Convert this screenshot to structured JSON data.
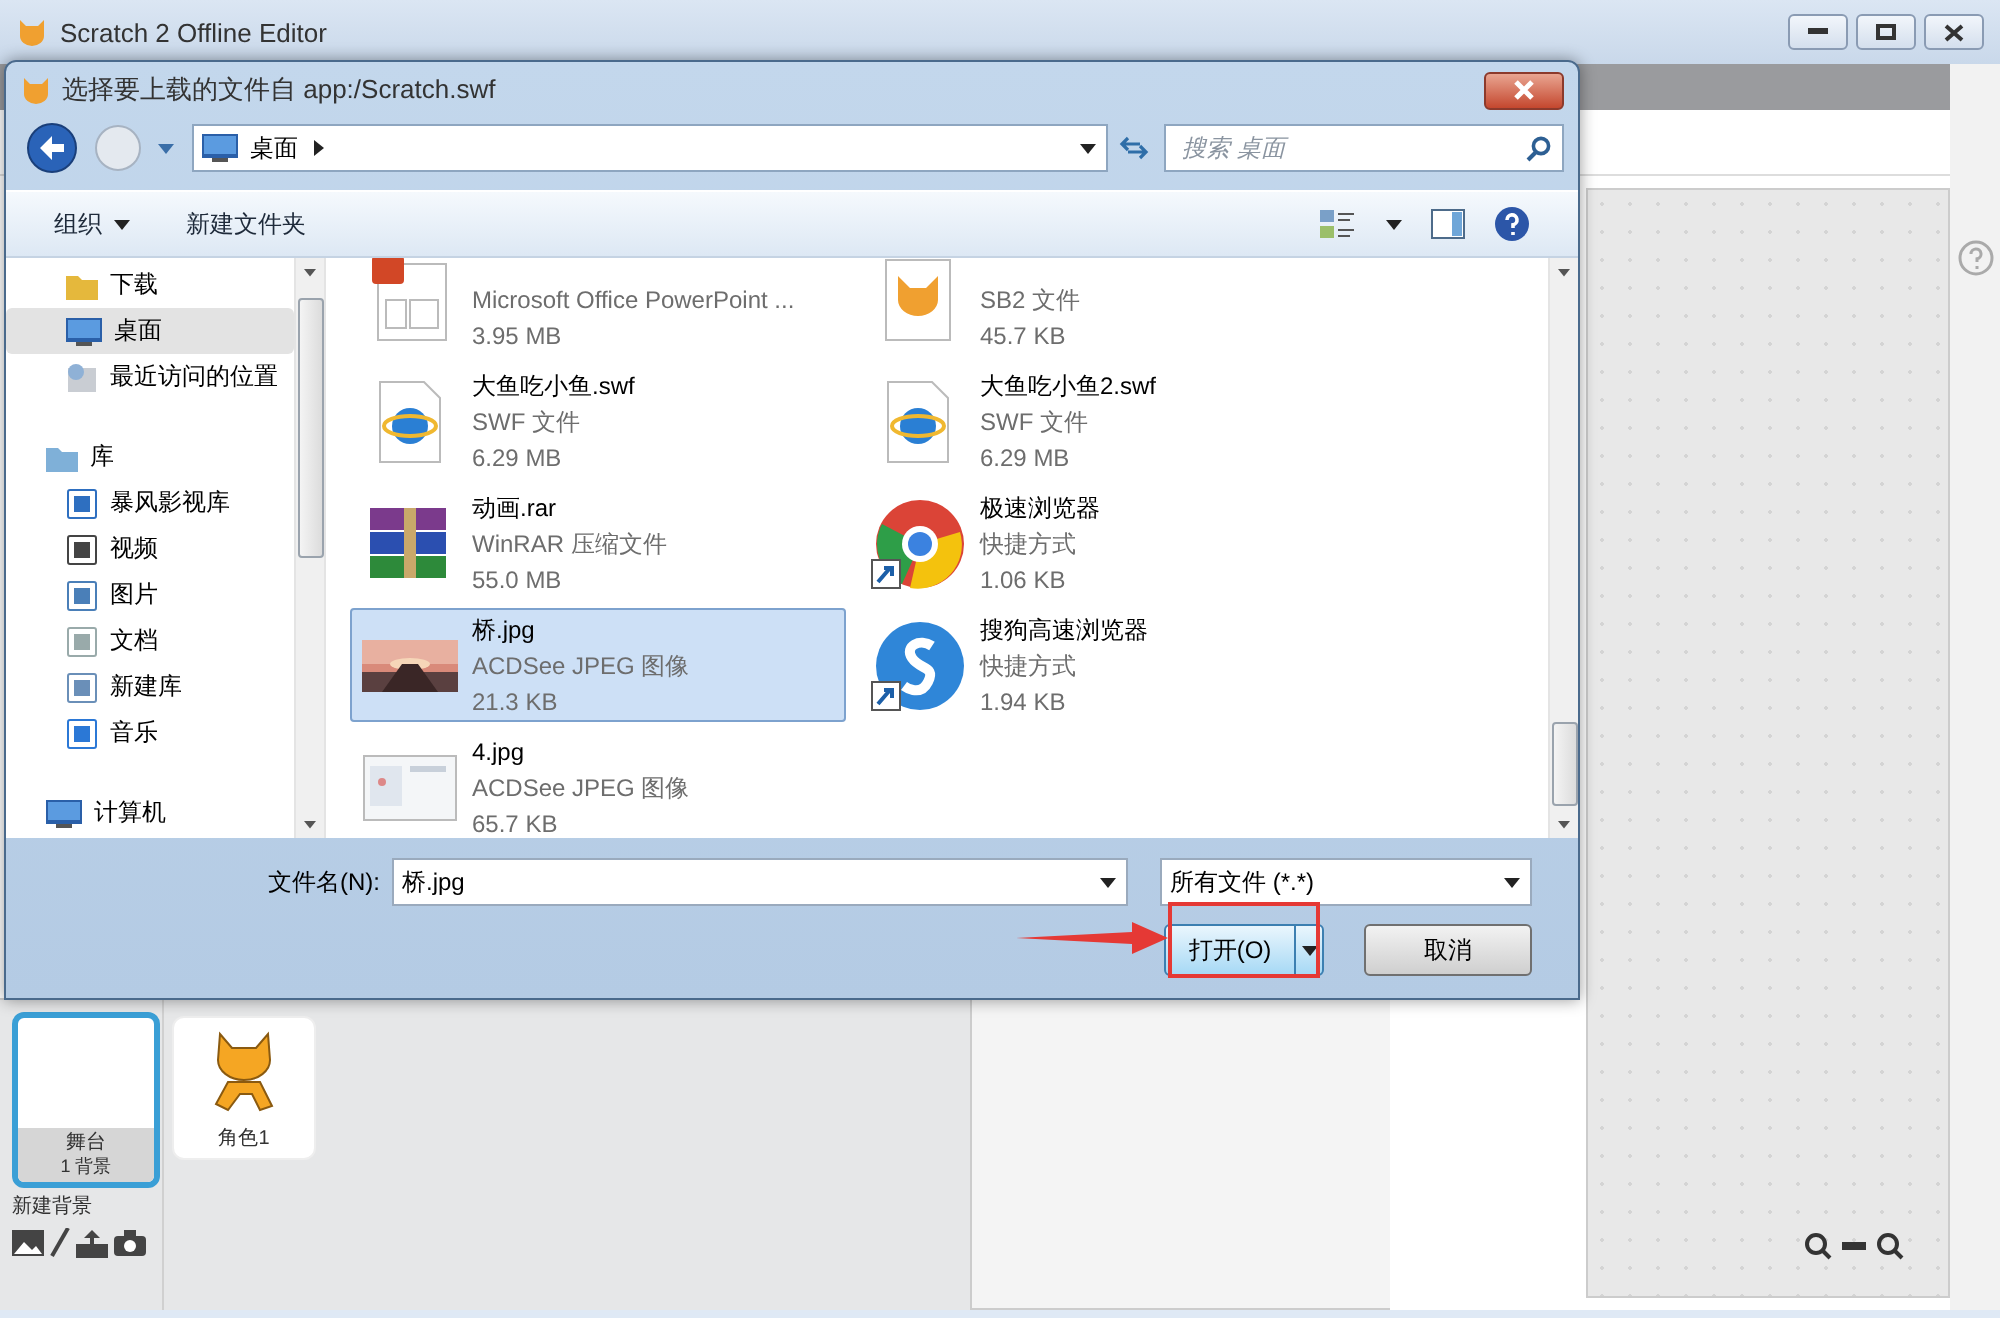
{
  "window": {
    "title": "Scratch 2 Offline Editor"
  },
  "sprite_panel": {
    "stage": {
      "label": "舞台",
      "count": "1 背景",
      "selected": true
    },
    "new_backdrop": "新建背景",
    "sprites": [
      {
        "name": "角色1",
        "selected": false
      }
    ]
  },
  "dialog": {
    "title": "选择要上载的文件自 app:/Scratch.swf",
    "address": {
      "crumb": "桌面"
    },
    "search": {
      "placeholder": "搜索 桌面"
    },
    "toolbar": {
      "organize": "组织",
      "new_folder": "新建文件夹"
    },
    "sidebar": {
      "groups": [
        {
          "items": [
            {
              "label": "下载",
              "selected": false
            },
            {
              "label": "桌面",
              "selected": true
            },
            {
              "label": "最近访问的位置",
              "selected": false
            }
          ]
        },
        {
          "label": "库",
          "items": [
            {
              "label": "暴风影视库",
              "selected": false
            },
            {
              "label": "视频",
              "selected": false
            },
            {
              "label": "图片",
              "selected": false
            },
            {
              "label": "文档",
              "selected": false
            },
            {
              "label": "新建库",
              "selected": false
            },
            {
              "label": "音乐",
              "selected": false
            }
          ]
        },
        {
          "label": "计算机"
        }
      ]
    },
    "files": [
      {
        "type": "Microsoft Office PowerPoint ...",
        "size": "3.95 MB",
        "selected": false
      },
      {
        "type": "SB2 文件",
        "size": "45.7 KB",
        "selected": false
      },
      {
        "name": "大鱼吃小鱼.swf",
        "type": "SWF 文件",
        "size": "6.29 MB",
        "selected": false
      },
      {
        "name": "大鱼吃小鱼2.swf",
        "type": "SWF 文件",
        "size": "6.29 MB",
        "selected": false
      },
      {
        "name": "动画.rar",
        "type": "WinRAR 压缩文件",
        "size": "55.0 MB",
        "selected": false
      },
      {
        "name": "极速浏览器",
        "type": "快捷方式",
        "size": "1.06 KB",
        "selected": false
      },
      {
        "name": "桥.jpg",
        "type": "ACDSee JPEG 图像",
        "size": "21.3 KB",
        "selected": true
      },
      {
        "name": "搜狗高速浏览器",
        "type": "快捷方式",
        "size": "1.94 KB",
        "selected": false
      },
      {
        "name": "4.jpg",
        "type": "ACDSee JPEG 图像",
        "size": "65.7 KB",
        "selected": false
      }
    ],
    "filename_label": "文件名(N):",
    "filename": "桥.jpg",
    "filter": "所有文件 (*.*)",
    "buttons": [
      {
        "kind": "split",
        "label": "打开(O)"
      },
      {
        "kind": "plain",
        "label": "取消"
      }
    ]
  }
}
